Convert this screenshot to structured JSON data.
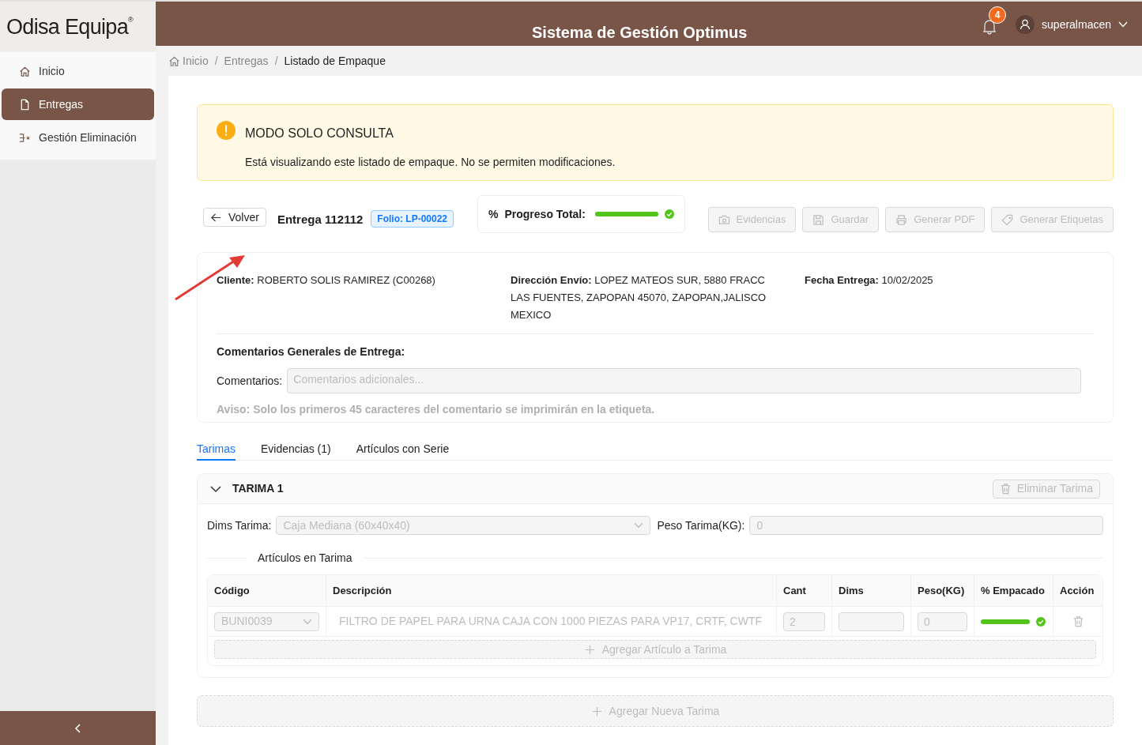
{
  "logo": {
    "text": "Odisa Equipa",
    "mark": "®"
  },
  "sidebar": {
    "items": [
      {
        "label": "Inicio",
        "kind": "home",
        "selected": false
      },
      {
        "label": "Entregas",
        "kind": "file",
        "selected": true
      },
      {
        "label": "Gestión Eliminación",
        "kind": "remove",
        "selected": false
      }
    ]
  },
  "header": {
    "title": "Sistema de Gestión Optimus",
    "notifications": "4",
    "user": "superalmacen"
  },
  "breadcrumb": {
    "items": [
      {
        "label": "Inicio",
        "current": false
      },
      {
        "label": "Entregas",
        "current": false
      },
      {
        "label": "Listado de Empaque",
        "current": true
      }
    ],
    "separators": [
      "/",
      "/"
    ]
  },
  "alert": {
    "title": "MODO SOLO CONSULTA",
    "message": "Está visualizando este listado de empaque. No se permiten modificaciones."
  },
  "toolbar": {
    "back": "Volver",
    "title": "Entrega 112112",
    "folio": "Folio: LP-00022",
    "progress_icon": "%",
    "progress_label": "Progreso Total:",
    "progress": {
      "level": 1,
      "complete": true
    },
    "buttons": [
      {
        "label": "Evidencias",
        "kind": "camera",
        "disabled": true
      },
      {
        "label": "Guardar",
        "kind": "save",
        "disabled": true
      },
      {
        "label": "Generar PDF",
        "kind": "printer",
        "disabled": true
      },
      {
        "label": "Generar Etiquetas",
        "kind": "tag",
        "disabled": true
      }
    ]
  },
  "details": {
    "fields": [
      {
        "label": "Cliente:",
        "value": "ROBERTO SOLIS RAMIREZ (C00268)"
      },
      {
        "label": "Dirección Envío:",
        "value": "LOPEZ MATEOS SUR, 5880 FRACC LAS FUENTES, ZAPOPAN 45070, ZAPOPAN,JALISCO MEXICO"
      },
      {
        "label": "Fecha Entrega:",
        "value": "10/02/2025"
      }
    ],
    "comments_title": "Comentarios Generales de Entrega:",
    "comments_label": "Comentarios:",
    "comments_placeholder": "Comentarios adicionales...",
    "notice": "Aviso: Solo los primeros 45 caracteres del comentario se imprimirán en la etiqueta."
  },
  "tabs": [
    {
      "label": "Tarimas",
      "selected": true
    },
    {
      "label": "Evidencias (1)",
      "selected": false
    },
    {
      "label": "Artículos con Serie",
      "selected": false
    }
  ],
  "pallet": {
    "title": "TARIMA 1",
    "expanded": true,
    "delete_button": "Eliminar Tarima",
    "dims_label": "Dims Tarima:",
    "dims_value": "Caja Mediana (60x40x40)",
    "weight_label": "Peso Tarima(KG):",
    "weight_value": "0",
    "items_title": "Artículos en Tarima",
    "table": {
      "columns": [
        "Código",
        "Descripción",
        "Cant",
        "Dims",
        "Peso(KG)",
        "% Empacado",
        "Acción"
      ],
      "rows": [
        {
          "code": "BUNI0039",
          "description": "FILTRO DE PAPEL PARA URNA CAJA CON 1000 PIEZAS PARA VP17, CRTF, CWTF",
          "qty": "2",
          "weight": "0",
          "level": 1,
          "complete": true
        }
      ]
    },
    "add_item": "Agregar Artículo a Tarima"
  },
  "add_pallet": "Agregar Nueva Tarima"
}
